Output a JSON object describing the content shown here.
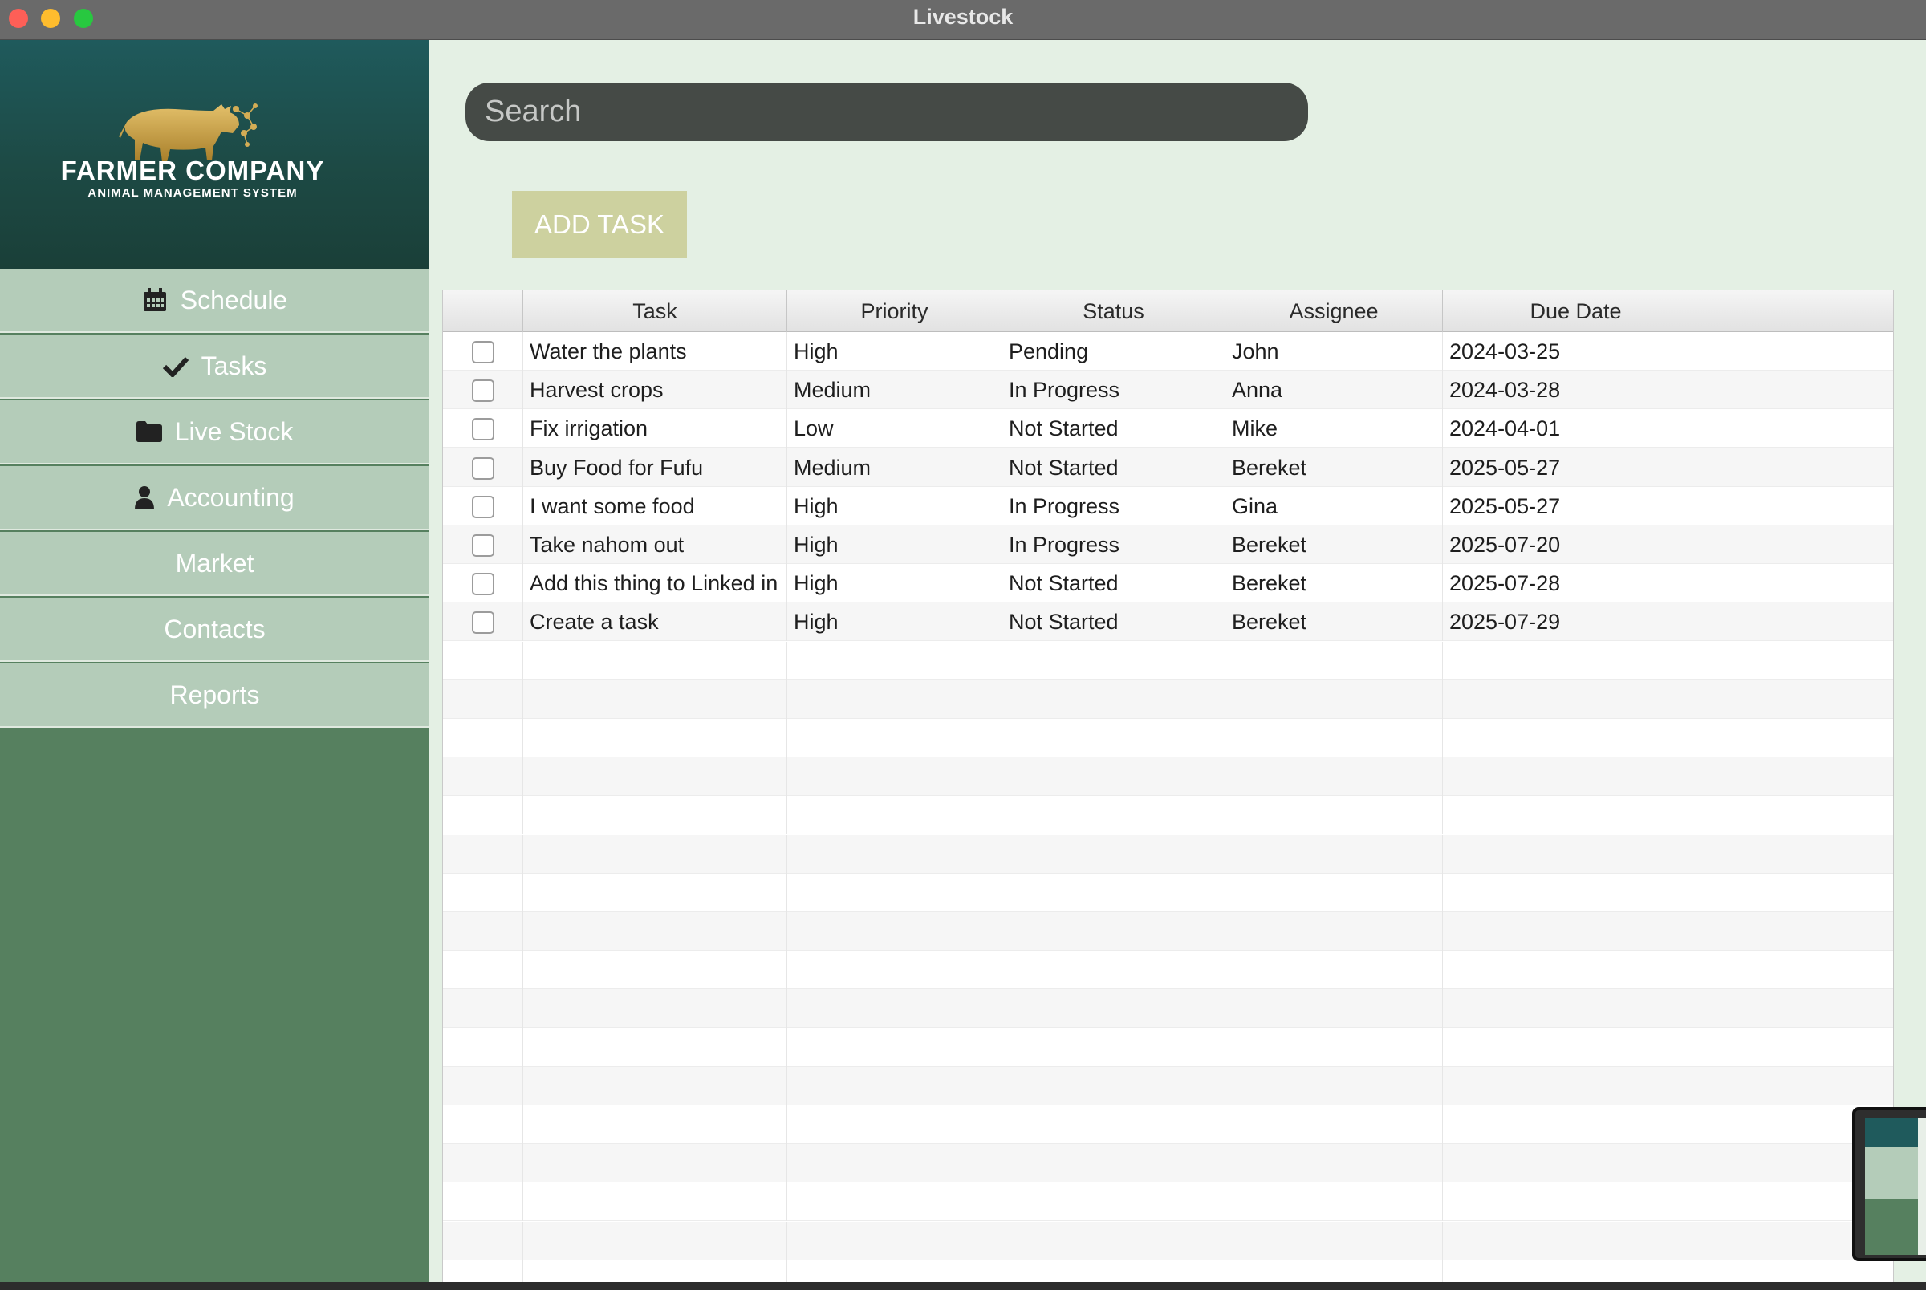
{
  "window": {
    "title": "Livestock"
  },
  "logo": {
    "title": "FARMER COMPANY",
    "subtitle": "ANIMAL MANAGEMENT SYSTEM"
  },
  "sidebar": {
    "items": [
      {
        "label": "Schedule",
        "icon": "calendar-icon"
      },
      {
        "label": "Tasks",
        "icon": "checkmark-icon"
      },
      {
        "label": "Live Stock",
        "icon": "folder-icon"
      },
      {
        "label": "Accounting",
        "icon": "user-icon"
      },
      {
        "label": "Market",
        "icon": ""
      },
      {
        "label": "Contacts",
        "icon": ""
      },
      {
        "label": "Reports",
        "icon": ""
      }
    ]
  },
  "search": {
    "placeholder": "Search",
    "value": ""
  },
  "toolbar": {
    "add_task_label": "ADD TASK"
  },
  "table": {
    "columns": [
      "",
      "Task",
      "Priority",
      "Status",
      "Assignee",
      "Due Date",
      ""
    ],
    "rows": [
      {
        "task": "Water the plants",
        "priority": "High",
        "status": "Pending",
        "assignee": "John",
        "due": "2024-03-25"
      },
      {
        "task": "Harvest crops",
        "priority": "Medium",
        "status": "In Progress",
        "assignee": "Anna",
        "due": "2024-03-28"
      },
      {
        "task": "Fix irrigation",
        "priority": "Low",
        "status": "Not Started",
        "assignee": "Mike",
        "due": "2024-04-01"
      },
      {
        "task": "Buy Food for Fufu",
        "priority": "Medium",
        "status": "Not Started",
        "assignee": "Bereket",
        "due": "2025-05-27"
      },
      {
        "task": "I want some food",
        "priority": "High",
        "status": "In Progress",
        "assignee": "Gina",
        "due": "2025-05-27"
      },
      {
        "task": "Take nahom out",
        "priority": "High",
        "status": "In Progress",
        "assignee": "Bereket",
        "due": "2025-07-20"
      },
      {
        "task": "Add this thing to Linked in",
        "priority": "High",
        "status": "Not Started",
        "assignee": "Bereket",
        "due": "2025-07-28"
      },
      {
        "task": "Create a task",
        "priority": "High",
        "status": "Not Started",
        "assignee": "Bereket",
        "due": "2025-07-29"
      }
    ]
  },
  "colors": {
    "sidebar_bg": "#56805f",
    "nav_item_bg": "#b4ccb9",
    "main_bg": "#e4f0e4",
    "search_bg": "#454a46",
    "add_button_bg": "#cdd19f",
    "logo_gold": "#c9a24a"
  }
}
